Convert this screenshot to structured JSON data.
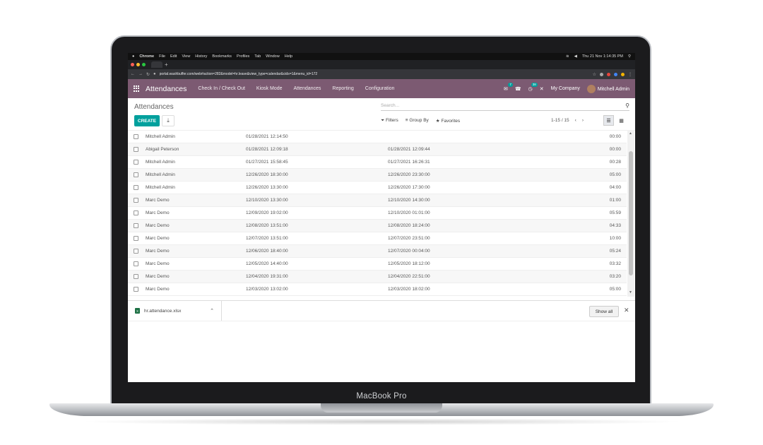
{
  "device": {
    "label": "MacBook Pro"
  },
  "mac_menubar": {
    "items": [
      "Chrome",
      "File",
      "Edit",
      "View",
      "History",
      "Bookmarks",
      "Profiles",
      "Tab",
      "Window",
      "Help"
    ],
    "clock": "Thu 21 Nov 1:14:35 PM"
  },
  "browser": {
    "url": "portal.washbuffer.com/web#action=282&model=hr.leave&view_type=calendar&cids=1&menu_id=172"
  },
  "odoo_nav": {
    "app_name": "Attendances",
    "menu": [
      "Check In / Check Out",
      "Kiosk Mode",
      "Attendances",
      "Reporting",
      "Configuration"
    ],
    "messages_badge": "7",
    "activity_badge": "38",
    "company": "My Company",
    "user": "Mitchell Admin"
  },
  "control_panel": {
    "breadcrumb": "Attendances",
    "search_placeholder": "Search...",
    "create_label": "CREATE",
    "filters_label": "Filters",
    "group_by_label": "Group By",
    "favorites_label": "Favorites",
    "pager": "1-15 / 15"
  },
  "attendances": [
    {
      "employee": "Mitchell Admin",
      "check_in": "01/28/2021 12:14:50",
      "check_out": "",
      "hours": "00:00"
    },
    {
      "employee": "Abigail Peterson",
      "check_in": "01/28/2021 12:09:18",
      "check_out": "01/28/2021 12:09:44",
      "hours": "00:00"
    },
    {
      "employee": "Mitchell Admin",
      "check_in": "01/27/2021 15:58:45",
      "check_out": "01/27/2021 16:26:31",
      "hours": "00:28"
    },
    {
      "employee": "Mitchell Admin",
      "check_in": "12/26/2020 18:30:00",
      "check_out": "12/26/2020 23:30:00",
      "hours": "05:00"
    },
    {
      "employee": "Mitchell Admin",
      "check_in": "12/26/2020 13:30:00",
      "check_out": "12/26/2020 17:30:00",
      "hours": "04:00"
    },
    {
      "employee": "Marc Demo",
      "check_in": "12/10/2020 13:30:00",
      "check_out": "12/10/2020 14:30:00",
      "hours": "01:00"
    },
    {
      "employee": "Marc Demo",
      "check_in": "12/09/2020 19:02:00",
      "check_out": "12/10/2020 01:01:00",
      "hours": "05:59"
    },
    {
      "employee": "Marc Demo",
      "check_in": "12/08/2020 13:51:00",
      "check_out": "12/08/2020 18:24:00",
      "hours": "04:33"
    },
    {
      "employee": "Marc Demo",
      "check_in": "12/07/2020 13:51:00",
      "check_out": "12/07/2020 23:51:00",
      "hours": "10:00"
    },
    {
      "employee": "Marc Demo",
      "check_in": "12/06/2020 18:40:00",
      "check_out": "12/07/2020 00:04:00",
      "hours": "05:24"
    },
    {
      "employee": "Marc Demo",
      "check_in": "12/05/2020 14:40:00",
      "check_out": "12/05/2020 18:12:00",
      "hours": "03:32"
    },
    {
      "employee": "Marc Demo",
      "check_in": "12/04/2020 19:31:00",
      "check_out": "12/04/2020 22:51:00",
      "hours": "03:20"
    },
    {
      "employee": "Marc Demo",
      "check_in": "12/03/2020 13:02:00",
      "check_out": "12/03/2020 18:02:00",
      "hours": "05:00"
    }
  ],
  "download_shelf": {
    "filename": "hr.attendance.xlsx",
    "show_all_label": "Show all"
  },
  "colors": {
    "odoo_purple": "#7c5a72",
    "odoo_teal": "#00a09d",
    "excel_green": "#1e7145"
  }
}
